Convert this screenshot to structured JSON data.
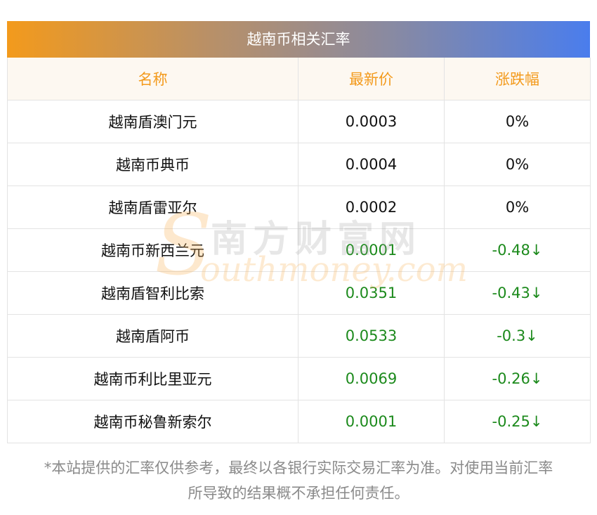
{
  "title": "越南币相关汇率",
  "columns": [
    "名称",
    "最新价",
    "涨跌幅"
  ],
  "rows": [
    {
      "name": "越南盾澳门元",
      "price": "0.0003",
      "change": "0%",
      "trend": "flat"
    },
    {
      "name": "越南币典币",
      "price": "0.0004",
      "change": "0%",
      "trend": "flat"
    },
    {
      "name": "越南盾雷亚尔",
      "price": "0.0002",
      "change": "0%",
      "trend": "flat"
    },
    {
      "name": "越南币新西兰元",
      "price": "0.0001",
      "change": "-0.48↓",
      "trend": "down"
    },
    {
      "name": "越南盾智利比索",
      "price": "0.0351",
      "change": "-0.43↓",
      "trend": "down"
    },
    {
      "name": "越南盾阿币",
      "price": "0.0533",
      "change": "-0.3↓",
      "trend": "down"
    },
    {
      "name": "越南币利比里亚元",
      "price": "0.0069",
      "change": "-0.26↓",
      "trend": "down"
    },
    {
      "name": "越南币秘鲁新索尔",
      "price": "0.0001",
      "change": "-0.25↓",
      "trend": "down"
    }
  ],
  "footnote": {
    "line1": "*本站提供的汇率仅供参考，最终以各银行实际交易汇率为准。对使用当前汇率",
    "line2": "所导致的结果概不承担任何责任。"
  },
  "watermark": {
    "letter": "S",
    "cn": "南方财富网",
    "en": "outhmoney.com"
  },
  "colors": {
    "header_text": "#f39a1c",
    "header_bg": "#fdf8f1",
    "down": "#1c8a1c",
    "gradient_start": "#f39a1c",
    "gradient_end": "#4a7ded"
  }
}
